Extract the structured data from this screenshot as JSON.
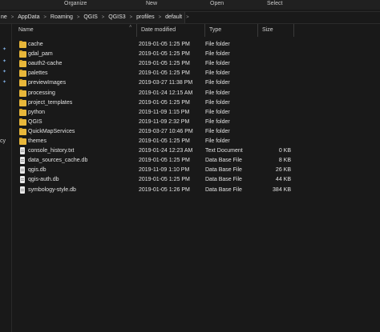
{
  "ribbon": {
    "organize": "Organize",
    "new": "New",
    "open": "Open",
    "select": "Select"
  },
  "address": {
    "crumbs": [
      "AppData",
      "Roaming",
      "QGIS",
      "QGIS3",
      "profiles",
      "default"
    ],
    "lead": "ne"
  },
  "columns": {
    "name": "Name",
    "date": "Date modified",
    "type": "Type",
    "size": "Size"
  },
  "leftpane_text": "cy",
  "files": [
    {
      "name": "cache",
      "date": "2019-01-05 1:25 PM",
      "type": "File folder",
      "size": "",
      "icon": "folder-icon"
    },
    {
      "name": "gdal_pam",
      "date": "2019-01-05 1:25 PM",
      "type": "File folder",
      "size": "",
      "icon": "folder-icon"
    },
    {
      "name": "oauth2-cache",
      "date": "2019-01-05 1:25 PM",
      "type": "File folder",
      "size": "",
      "icon": "folder-icon"
    },
    {
      "name": "palettes",
      "date": "2019-01-05 1:25 PM",
      "type": "File folder",
      "size": "",
      "icon": "folder-icon"
    },
    {
      "name": "previewImages",
      "date": "2019-03-27 11:38 PM",
      "type": "File folder",
      "size": "",
      "icon": "folder-icon"
    },
    {
      "name": "processing",
      "date": "2019-01-24 12:15 AM",
      "type": "File folder",
      "size": "",
      "icon": "folder-icon"
    },
    {
      "name": "project_templates",
      "date": "2019-01-05 1:25 PM",
      "type": "File folder",
      "size": "",
      "icon": "folder-icon"
    },
    {
      "name": "python",
      "date": "2019-11-09 1:15 PM",
      "type": "File folder",
      "size": "",
      "icon": "folder-icon"
    },
    {
      "name": "QGIS",
      "date": "2019-11-09 2:32 PM",
      "type": "File folder",
      "size": "",
      "icon": "folder-icon"
    },
    {
      "name": "QuickMapServices",
      "date": "2019-03-27 10:46 PM",
      "type": "File folder",
      "size": "",
      "icon": "folder-icon"
    },
    {
      "name": "themes",
      "date": "2019-01-05 1:25 PM",
      "type": "File folder",
      "size": "",
      "icon": "folder-icon"
    },
    {
      "name": "console_history.txt",
      "date": "2019-01-24 12:23 AM",
      "type": "Text Document",
      "size": "0 KB",
      "icon": "text-file-icon"
    },
    {
      "name": "data_sources_cache.db",
      "date": "2019-01-05 1:25 PM",
      "type": "Data Base File",
      "size": "8 KB",
      "icon": "db-file-icon"
    },
    {
      "name": "qgis.db",
      "date": "2019-11-09 1:10 PM",
      "type": "Data Base File",
      "size": "26 KB",
      "icon": "db-file-icon"
    },
    {
      "name": "qgis-auth.db",
      "date": "2019-01-05 1:25 PM",
      "type": "Data Base File",
      "size": "44 KB",
      "icon": "db-file-icon"
    },
    {
      "name": "symbology-style.db",
      "date": "2019-01-05 1:26 PM",
      "type": "Data Base File",
      "size": "384 KB",
      "icon": "db-file-icon"
    }
  ]
}
